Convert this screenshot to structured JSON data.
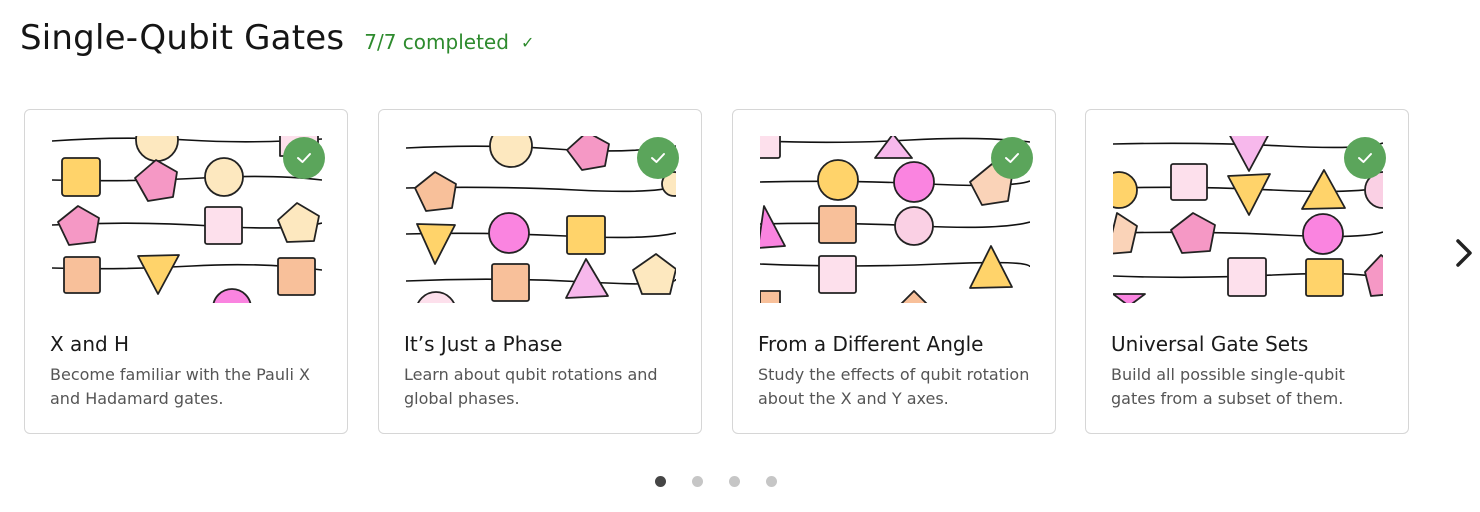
{
  "section": {
    "title": "Single-Qubit Gates",
    "progress_text": "7/7 completed",
    "progress_icon": "check-icon"
  },
  "cards": [
    {
      "title": "X and H",
      "description": "Become familiar with the Pauli X and Hadamard gates.",
      "completed": true
    },
    {
      "title": "It’s Just a Phase",
      "description": "Learn about qubit rotations and global phases.",
      "completed": true
    },
    {
      "title": "From a Different Angle",
      "description": "Study the effects of qubit rotation about the X and Y axes.",
      "completed": true
    },
    {
      "title": "Universal Gate Sets",
      "description": "Build all possible single-qubit gates from a subset of them.",
      "completed": true
    }
  ],
  "carousel": {
    "page_count": 4,
    "active_page": 1,
    "next_icon": "chevron-right-icon"
  },
  "colors": {
    "completed_green": "#2e8b2e",
    "badge_green": "#5ba55b",
    "card_border": "#d6d6d6",
    "shape_orange": "#ffd36a",
    "shape_pink": "#f598c5",
    "shape_cream": "#fde8bf",
    "shape_light_pink": "#fde0ec",
    "shape_peach": "#f8c09a",
    "shape_magenta": "#fa84e0"
  }
}
